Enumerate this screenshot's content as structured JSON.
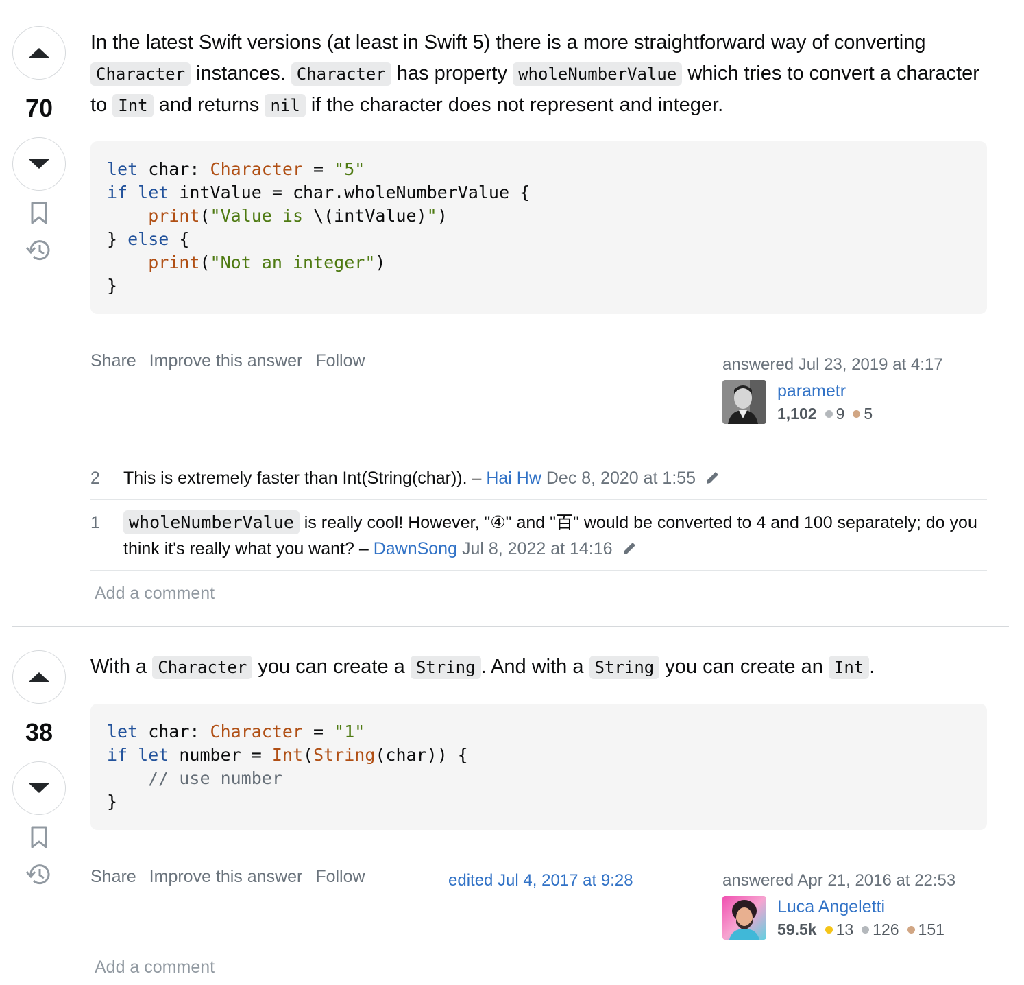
{
  "answers": [
    {
      "score": "70",
      "prose": {
        "t1": "In the latest Swift versions (at least in Swift 5) there is a more straightforward way of converting ",
        "c1": "Character",
        "t2": " instances. ",
        "c2": "Character",
        "t3": " has property ",
        "c3": "wholeNumberValue",
        "t4": " which tries to convert a character to ",
        "c4": "Int",
        "t5": " and returns ",
        "c5": "nil",
        "t6": " if the character does not represent and integer."
      },
      "code": {
        "l1_kw": "let",
        "l1_a": " char: ",
        "l1_ty": "Character",
        "l1_b": " = ",
        "l1_st": "\"5\"",
        "l2_kw1": "if",
        "l2_kw2": "let",
        "l2_a": " intValue = char.wholeNumberValue {",
        "l3_fn": "print",
        "l3_a": "(",
        "l3_st1": "\"Value is ",
        "l3_b": "\\(intValue)",
        "l3_st2": "\"",
        "l3_c": ")",
        "l4_a": "} ",
        "l4_kw": "else",
        "l4_b": " {",
        "l5_fn": "print",
        "l5_a": "(",
        "l5_st": "\"Not an integer\"",
        "l5_b": ")",
        "l6": "}"
      },
      "menu": {
        "share": "Share",
        "improve": "Improve this answer",
        "follow": "Follow"
      },
      "answered": "answered Jul 23, 2019 at 4:17",
      "user": {
        "name": "parametr",
        "rep": "1,102",
        "silver": "9",
        "bronze": "5"
      },
      "comments": [
        {
          "score": "2",
          "text": "This is extremely faster than Int(String(char)). – ",
          "user": "Hai Hw",
          "date": " Dec 8, 2020 at 1:55"
        },
        {
          "score": "1",
          "code": "wholeNumberValue",
          "text": " is really cool! However, \"④\" and \"百\" would be converted to 4 and 100 separately; do you think it's really what you want? – ",
          "user": "DawnSong",
          "date": " Jul 8, 2022 at 14:16"
        }
      ],
      "add_comment": "Add a comment"
    },
    {
      "score": "38",
      "prose": {
        "t1": "With a ",
        "c1": "Character",
        "t2": " you can create a ",
        "c2": "String",
        "t3": ". And with a ",
        "c3": "String",
        "t4": " you can create an ",
        "c4": "Int",
        "t5": "."
      },
      "code": {
        "l1_kw": "let",
        "l1_a": " char: ",
        "l1_ty": "Character",
        "l1_b": " = ",
        "l1_st": "\"1\"",
        "l2_kw1": "if",
        "l2_kw2": "let",
        "l2_a": " number = ",
        "l2_ty1": "Int",
        "l2_b": "(",
        "l2_ty2": "String",
        "l2_c": "(char)) {",
        "l3_cm": "// use number",
        "l4": "}"
      },
      "menu": {
        "share": "Share",
        "improve": "Improve this answer",
        "follow": "Follow"
      },
      "edited": "edited Jul 4, 2017 at 9:28",
      "answered": "answered Apr 21, 2016 at 22:53",
      "user": {
        "name": "Luca Angeletti",
        "rep": "59.5k",
        "gold": "13",
        "silver": "126",
        "bronze": "151"
      },
      "add_comment": "Add a comment"
    }
  ],
  "icons": [
    "upvote-icon",
    "downvote-icon",
    "bookmark-icon",
    "history-icon",
    "pencil-icon"
  ]
}
